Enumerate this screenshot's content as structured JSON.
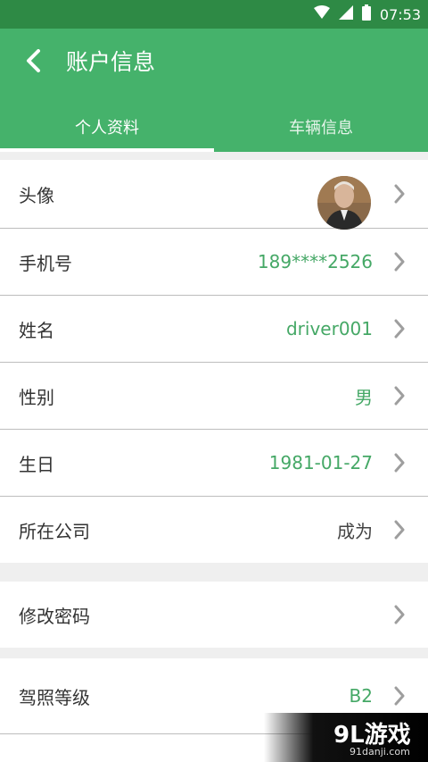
{
  "status_bar": {
    "time": "07:53",
    "icons": [
      "wifi-icon",
      "signal-icon",
      "battery-icon"
    ]
  },
  "header": {
    "title": "账户信息",
    "back_icon": "chevron-left-icon"
  },
  "tabs": [
    {
      "label": "个人资料",
      "active": true
    },
    {
      "label": "车辆信息",
      "active": false
    }
  ],
  "profile": [
    {
      "label": "头像",
      "value": ""
    },
    {
      "label": "手机号",
      "value": "189****2526"
    },
    {
      "label": "姓名",
      "value": "driver001"
    },
    {
      "label": "性别",
      "value": "男"
    },
    {
      "label": "生日",
      "value": "1981-01-27"
    },
    {
      "label": "所在公司",
      "value": "成为"
    }
  ],
  "security": [
    {
      "label": "修改密码"
    }
  ],
  "license": [
    {
      "label": "驾照等级",
      "value": "B2"
    }
  ],
  "watermark": {
    "main": "9L游戏",
    "sub": "91danji.com"
  },
  "colors": {
    "status_bar": "#2e8a45",
    "app_bar": "#45b26b",
    "value_green": "#45a866"
  }
}
